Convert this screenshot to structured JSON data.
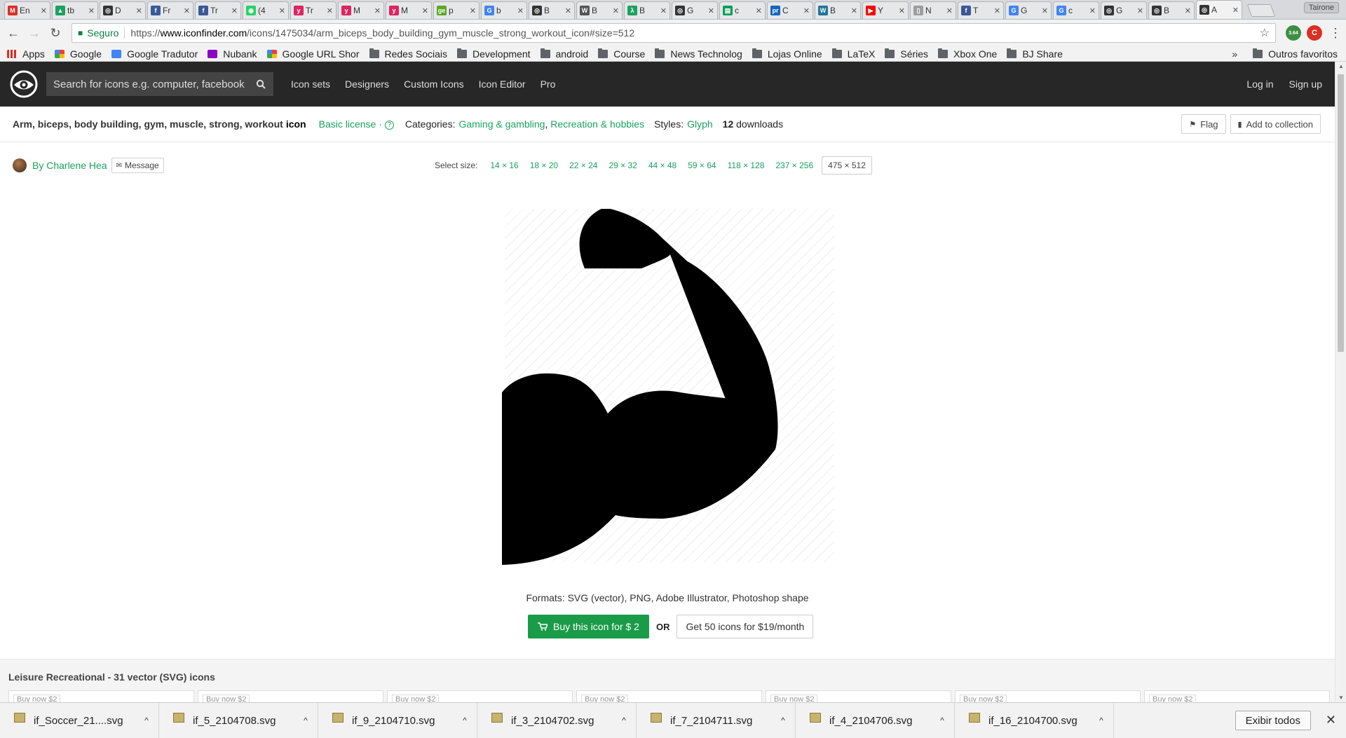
{
  "browser": {
    "tabs": [
      {
        "title": "En",
        "favicon_color": "#d93025",
        "favicon_glyph": "M"
      },
      {
        "title": "tb",
        "favicon_color": "#1aa260",
        "favicon_glyph": "▲"
      },
      {
        "title": "D",
        "favicon_color": "#333333",
        "favicon_glyph": "◎"
      },
      {
        "title": "Fr",
        "favicon_color": "#3b5998",
        "favicon_glyph": "f"
      },
      {
        "title": "Tr",
        "favicon_color": "#3b5998",
        "favicon_glyph": "f"
      },
      {
        "title": "(4",
        "favicon_color": "#25d366",
        "favicon_glyph": "◉"
      },
      {
        "title": "Tr",
        "favicon_color": "#e0245e",
        "favicon_glyph": "y"
      },
      {
        "title": "M",
        "favicon_color": "#e0245e",
        "favicon_glyph": "y"
      },
      {
        "title": "M",
        "favicon_color": "#e0245e",
        "favicon_glyph": "y"
      },
      {
        "title": "p",
        "favicon_color": "#5ba829",
        "favicon_glyph": "ge"
      },
      {
        "title": "b",
        "favicon_color": "#4285f4",
        "favicon_glyph": "G"
      },
      {
        "title": "B",
        "favicon_color": "#333333",
        "favicon_glyph": "◎"
      },
      {
        "title": "B",
        "favicon_color": "#555555",
        "favicon_glyph": "W"
      },
      {
        "title": "B",
        "favicon_color": "#1aa260",
        "favicon_glyph": "λ"
      },
      {
        "title": "G",
        "favicon_color": "#333333",
        "favicon_glyph": "◎"
      },
      {
        "title": "c",
        "favicon_color": "#0f9d58",
        "favicon_glyph": "▤"
      },
      {
        "title": "C",
        "favicon_color": "#1565c0",
        "favicon_glyph": "pr"
      },
      {
        "title": "B",
        "favicon_color": "#21759b",
        "favicon_glyph": "W"
      },
      {
        "title": "Y",
        "favicon_color": "#ff0000",
        "favicon_glyph": "▶"
      },
      {
        "title": "N",
        "favicon_color": "#9e9e9e",
        "favicon_glyph": "▯"
      },
      {
        "title": "T",
        "favicon_color": "#3b5998",
        "favicon_glyph": "f"
      },
      {
        "title": "G",
        "favicon_color": "#4285f4",
        "favicon_glyph": "G"
      },
      {
        "title": "c",
        "favicon_color": "#4285f4",
        "favicon_glyph": "G"
      },
      {
        "title": "G",
        "favicon_color": "#333333",
        "favicon_glyph": "◎"
      },
      {
        "title": "B",
        "favicon_color": "#333333",
        "favicon_glyph": "◎"
      },
      {
        "title": "A",
        "favicon_color": "#333333",
        "favicon_glyph": "◎"
      }
    ],
    "profile_name": "Tairone",
    "secure_label": "Seguro",
    "url_scheme": "https://",
    "url_host": "www.iconfinder.com",
    "url_path": "/icons/1475034/arm_biceps_body_building_gym_muscle_strong_workout_icon#size=512",
    "extension_badge": "3.64"
  },
  "bookmarks": {
    "items": [
      {
        "label": "Apps",
        "icon": "apps-grid-icon"
      },
      {
        "label": "Google",
        "icon": "google-icon"
      },
      {
        "label": "Google Tradutor",
        "icon": "translate-icon"
      },
      {
        "label": "Nubank",
        "icon": "nubank-icon"
      },
      {
        "label": "Google URL Shor",
        "icon": "google-icon"
      },
      {
        "label": "Redes Sociais",
        "icon": "folder-icon"
      },
      {
        "label": "Development",
        "icon": "folder-icon"
      },
      {
        "label": "android",
        "icon": "folder-icon"
      },
      {
        "label": "Course",
        "icon": "folder-icon"
      },
      {
        "label": "News Technolog",
        "icon": "folder-icon"
      },
      {
        "label": "Lojas Online",
        "icon": "folder-icon"
      },
      {
        "label": "LaTeX",
        "icon": "folder-icon"
      },
      {
        "label": "Séries",
        "icon": "folder-icon"
      },
      {
        "label": "Xbox One",
        "icon": "folder-icon"
      },
      {
        "label": "BJ Share",
        "icon": "folder-icon"
      }
    ],
    "overflow": "»",
    "other_label": "Outros favoritos"
  },
  "site": {
    "search_placeholder": "Search for icons e.g. computer, facebook",
    "nav": [
      "Icon sets",
      "Designers",
      "Custom Icons",
      "Icon Editor",
      "Pro"
    ],
    "login": "Log in",
    "signup": "Sign up"
  },
  "icon": {
    "tags": "Arm, biceps, body building, gym, muscle, strong, workout",
    "word": "icon",
    "license": "Basic license ·",
    "categories_label": "Categories:",
    "categories": [
      "Gaming & gambling",
      "Recreation & hobbies"
    ],
    "styles_label": "Styles:",
    "style": "Glyph",
    "downloads_count": "12",
    "downloads_label": "downloads",
    "flag": "Flag",
    "add_collection": "Add to collection",
    "author": "By Charlene Hea",
    "message": "Message",
    "select_size_label": "Select size:",
    "sizes": [
      "14 × 16",
      "18 × 20",
      "22 × 24",
      "29 × 32",
      "44 × 48",
      "59 × 64",
      "118 × 128",
      "237 × 256"
    ],
    "selected_size": "475 × 512",
    "formats": "Formats: SVG (vector), PNG, Adobe Illustrator, Photoshop shape",
    "buy_label": "Buy this icon for $ 2",
    "or_label": "OR",
    "subscription_label": "Get 50 icons for $19/month"
  },
  "related": {
    "title": "Leisure Recreational - 31 vector (SVG) icons",
    "card_label": "Buy now $2"
  },
  "downloads": {
    "files": [
      "if_Soccer_21....svg",
      "if_5_2104708.svg",
      "if_9_2104710.svg",
      "if_3_2104702.svg",
      "if_7_2104711.svg",
      "if_4_2104706.svg",
      "if_16_2104700.svg"
    ],
    "show_all": "Exibir todos"
  },
  "colors": {
    "accent_green": "#1aa260",
    "buy_green": "#1a9b48",
    "header_bg": "#272727"
  }
}
